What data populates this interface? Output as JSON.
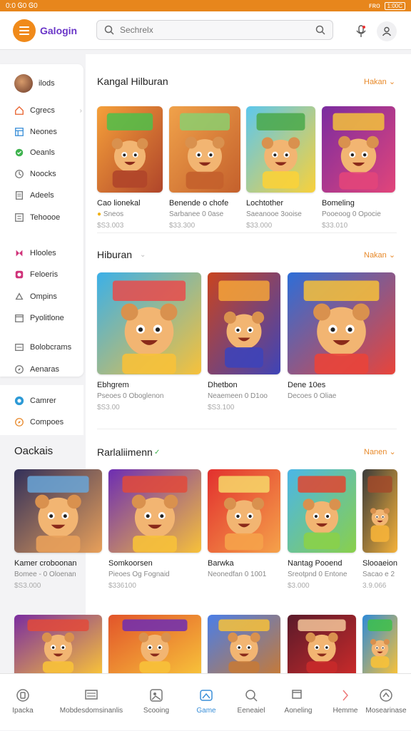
{
  "status": {
    "time": "0:0",
    "left_icons": "Ꮆ0 Ꮆ0",
    "battery": "1:00C",
    "network": "ꜰʀᴏ"
  },
  "header": {
    "logo": "Galogin",
    "search_placeholder": "Sechrelx"
  },
  "sidebar": {
    "profile_label": "ilods",
    "items": [
      {
        "label": "Cgrecs",
        "icon": "home-icon",
        "color": "#e8612c"
      },
      {
        "label": "Neones",
        "icon": "grid-icon",
        "color": "#3a8fd8"
      },
      {
        "label": "Oeanls",
        "icon": "chat-icon",
        "color": "#3fb34f"
      },
      {
        "label": "Noocks",
        "icon": "clock-icon",
        "color": "#777"
      },
      {
        "label": "Adeels",
        "icon": "doc-icon",
        "color": "#777"
      },
      {
        "label": "Tehoooe",
        "icon": "list-icon",
        "color": "#777"
      },
      {
        "label": "Hlooles",
        "icon": "butterfly-icon",
        "color": "#d0337a"
      },
      {
        "label": "Feloeris",
        "icon": "flag-icon",
        "color": "#d0337a"
      },
      {
        "label": "Ompins",
        "icon": "pin-icon",
        "color": "#777"
      },
      {
        "label": "Pyolitlone",
        "icon": "calendar-icon",
        "color": "#777"
      },
      {
        "label": "Bolobcrams",
        "icon": "window-icon",
        "color": "#777"
      },
      {
        "label": "Aenaras",
        "icon": "compass-icon",
        "color": "#777"
      }
    ],
    "extra": [
      {
        "label": "Camrer",
        "icon": "camera-icon",
        "color": "#2d9ad6"
      },
      {
        "label": "Compoes",
        "icon": "compass-icon",
        "color": "#e8892b"
      }
    ],
    "section_title": "Oackais"
  },
  "sections": [
    {
      "title": "Kangal Hilburan",
      "see_all": "Hakan",
      "cards": [
        {
          "title": "Cao lionekal",
          "sub": "Sneos",
          "price": "$S3.003",
          "art": "bear-camera"
        },
        {
          "title": "Benende o chofe",
          "sub": "Sarbanee 0 0ase",
          "price": "$33.300",
          "art": "dogs-house"
        },
        {
          "title": "Lochtother",
          "sub": "Saeanooe 3ooise",
          "price": "$33.000",
          "art": "cat-sunny"
        },
        {
          "title": "Bomeling",
          "sub": "Pooeoog 0 Opocie",
          "price": "$33.010",
          "art": "hero-purple"
        }
      ]
    },
    {
      "title": "Hiburan",
      "see_all": "Nakan",
      "cards": [
        {
          "title": "Ebhgrem",
          "sub": "Pseoes 0 Oboglenon",
          "price": "$S3.00",
          "art": "kids-party"
        },
        {
          "title": "Dhetbon",
          "sub": "Neaemeen 0 D1oo",
          "price": "$S3.100",
          "art": "robot-orange"
        },
        {
          "title": "Dene 10es",
          "sub": "Decoes 0 Oliae",
          "price": "",
          "art": "hero-blue"
        }
      ]
    },
    {
      "title": "Rarlaliimenn",
      "see_all": "Nanen",
      "cards": [
        {
          "title": "Kamer croboonan",
          "sub": "Bomee - 0 Oloenan",
          "price": "$S3.000",
          "art": "pilot"
        },
        {
          "title": "Somkoorsen",
          "sub": "Pieoes Og Fognaid",
          "price": "$336100",
          "art": "blbin"
        },
        {
          "title": "Barwka",
          "sub": "Neonedfan 0 1001",
          "price": "",
          "art": "bear-red"
        },
        {
          "title": "Nantag Pooend",
          "sub": "Sreotpnd 0 Entone",
          "price": "$3.000",
          "art": "adventure"
        },
        {
          "title": "Slooaeion",
          "sub": "Sacao e 2",
          "price": "3.9.066",
          "art": "side"
        }
      ]
    }
  ],
  "bottom_row": [
    "bear-purple",
    "cat-fire",
    "bear-blue",
    "hat-red",
    "small"
  ],
  "bottom_nav": [
    {
      "label": "Ipacka",
      "icon": "circle-icon"
    },
    {
      "label": "Mobdesdomsinanlis",
      "icon": "monitor-icon"
    },
    {
      "label": "Scooing",
      "icon": "photo-icon"
    },
    {
      "label": "Game",
      "icon": "gamepad-icon"
    },
    {
      "label": "Eeneaiel",
      "icon": "search-icon"
    },
    {
      "label": "Aoneling",
      "icon": "calendar-icon"
    },
    {
      "label": "Hemme",
      "icon": "chevron-right-icon"
    },
    {
      "label": "Mosearinase",
      "icon": "gauge-icon"
    }
  ],
  "colors": {
    "accent": "#e7861c",
    "active_nav": "#3a8fd8",
    "see_all": "#e88a2b"
  }
}
